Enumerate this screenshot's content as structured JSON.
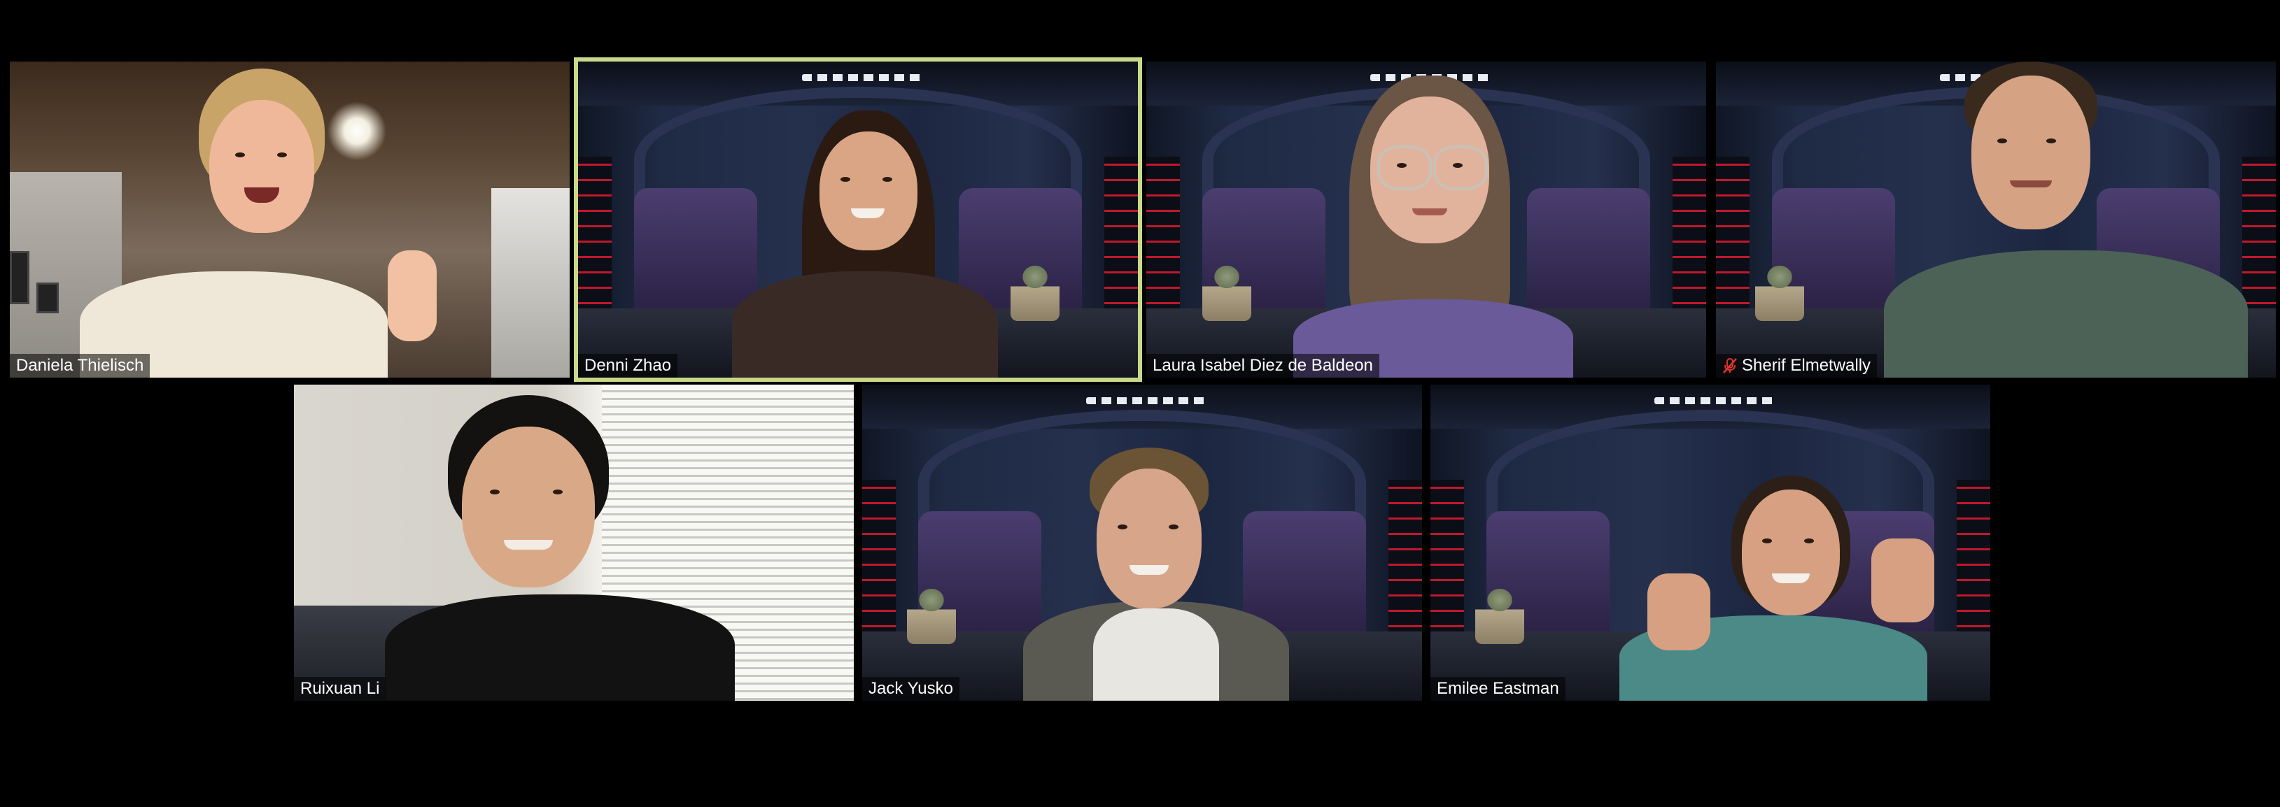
{
  "meeting": {
    "participants": [
      {
        "name": "Daniela Thielisch",
        "active_speaker": false,
        "muted": false
      },
      {
        "name": "Denni Zhao",
        "active_speaker": true,
        "muted": false
      },
      {
        "name": "Laura Isabel Diez de Baldeon",
        "active_speaker": false,
        "muted": false
      },
      {
        "name": "Sherif Elmetwally",
        "active_speaker": false,
        "muted": true
      },
      {
        "name": "Ruixuan Li",
        "active_speaker": false,
        "muted": false
      },
      {
        "name": "Jack Yusko",
        "active_speaker": false,
        "muted": false
      },
      {
        "name": "Emilee Eastman",
        "active_speaker": false,
        "muted": false
      }
    ]
  },
  "icons": {
    "muted": "microphone-muted-icon"
  },
  "colors": {
    "active_speaker_border": "#c8d98a",
    "mute_icon": "#e0342c",
    "background": "#000000",
    "label_text": "#ffffff"
  }
}
